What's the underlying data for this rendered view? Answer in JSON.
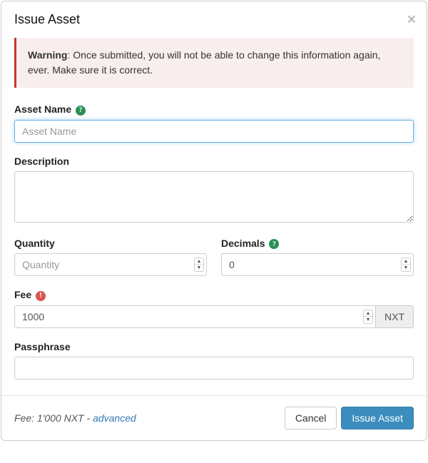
{
  "header": {
    "title": "Issue Asset"
  },
  "alert": {
    "prefix": "Warning",
    "text": ": Once submitted, you will not be able to change this information again, ever. Make sure it is correct."
  },
  "fields": {
    "asset_name": {
      "label": "Asset Name",
      "placeholder": "Asset Name",
      "value": ""
    },
    "description": {
      "label": "Description",
      "value": ""
    },
    "quantity": {
      "label": "Quantity",
      "placeholder": "Quantity",
      "value": ""
    },
    "decimals": {
      "label": "Decimals",
      "value": "0"
    },
    "fee": {
      "label": "Fee",
      "value": "1000",
      "unit": "NXT"
    },
    "passphrase": {
      "label": "Passphrase",
      "value": ""
    }
  },
  "footer": {
    "fee_label": "Fee",
    "fee_value": "1'000 NXT",
    "advanced": "advanced",
    "cancel": "Cancel",
    "submit": "Issue Asset"
  }
}
